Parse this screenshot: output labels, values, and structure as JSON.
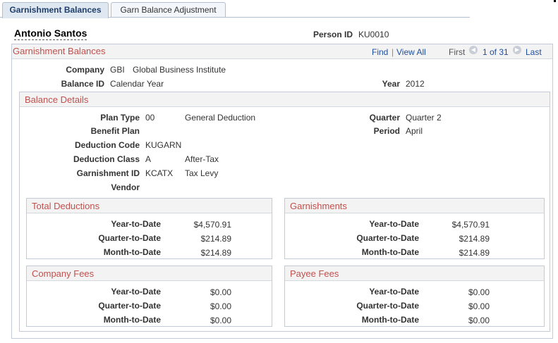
{
  "tabs": [
    {
      "label": "Garnishment Balances"
    },
    {
      "label": "Garn Balance Adjustment"
    }
  ],
  "employee": {
    "name": "Antonio Santos",
    "person_id_label": "Person ID",
    "person_id": "KU0010"
  },
  "main": {
    "title": "Garnishment Balances",
    "find": "Find",
    "sep": "|",
    "view_all": "View All",
    "first": "First",
    "page": "1 of 31",
    "last": "Last",
    "company_label": "Company",
    "company_code": "GBI",
    "company_name": "Global Business Institute",
    "balance_id_label": "Balance ID",
    "balance_id": "Calendar Year",
    "year_label": "Year",
    "year": "2012"
  },
  "details": {
    "title": "Balance Details",
    "plan_type_label": "Plan Type",
    "plan_type_code": "00",
    "plan_type_desc": "General Deduction",
    "benefit_plan_label": "Benefit Plan",
    "deduction_code_label": "Deduction Code",
    "deduction_code": "KUGARN",
    "deduction_class_label": "Deduction Class",
    "deduction_class_code": "A",
    "deduction_class_desc": "After-Tax",
    "garnishment_id_label": "Garnishment ID",
    "garnishment_id": "KCATX",
    "garnishment_desc": "Tax Levy",
    "vendor_label": "Vendor",
    "quarter_label": "Quarter",
    "quarter": "Quarter 2",
    "period_label": "Period",
    "period": "April"
  },
  "panels": {
    "total_deductions": {
      "title": "Total Deductions",
      "rows": [
        {
          "label": "Year-to-Date",
          "value": "$4,570.91"
        },
        {
          "label": "Quarter-to-Date",
          "value": "$214.89"
        },
        {
          "label": "Month-to-Date",
          "value": "$214.89"
        }
      ]
    },
    "garnishments": {
      "title": "Garnishments",
      "rows": [
        {
          "label": "Year-to-Date",
          "value": "$4,570.91"
        },
        {
          "label": "Quarter-to-Date",
          "value": "$214.89"
        },
        {
          "label": "Month-to-Date",
          "value": "$214.89"
        }
      ]
    },
    "company_fees": {
      "title": "Company Fees",
      "rows": [
        {
          "label": "Year-to-Date",
          "value": "$0.00"
        },
        {
          "label": "Quarter-to-Date",
          "value": "$0.00"
        },
        {
          "label": "Month-to-Date",
          "value": "$0.00"
        }
      ]
    },
    "payee_fees": {
      "title": "Payee Fees",
      "rows": [
        {
          "label": "Year-to-Date",
          "value": "$0.00"
        },
        {
          "label": "Quarter-to-Date",
          "value": "$0.00"
        },
        {
          "label": "Month-to-Date",
          "value": "$0.00"
        }
      ]
    }
  }
}
